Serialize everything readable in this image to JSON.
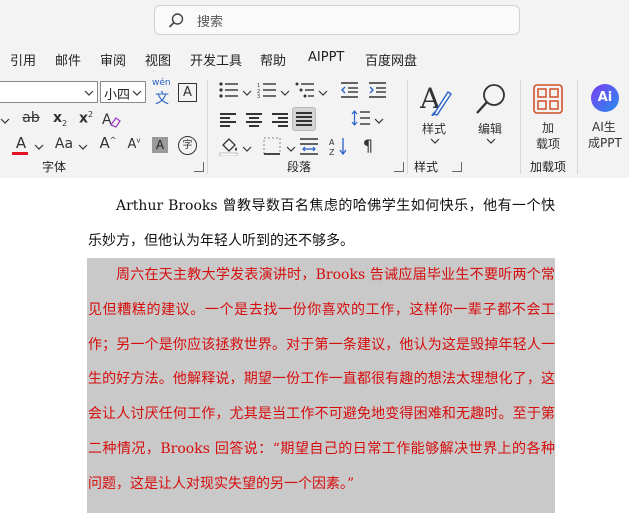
{
  "search": {
    "placeholder": "搜索"
  },
  "menu": [
    "引用",
    "邮件",
    "审阅",
    "视图",
    "开发工具",
    "帮助",
    "AIPPT",
    "百度网盘"
  ],
  "font": {
    "size_value": "小四",
    "phonetic_top": "wén",
    "char_border_glyph": "A"
  },
  "buttons": {
    "style": "样式",
    "edit": "编辑",
    "addin_line1": "加",
    "addin_line2": "载项",
    "ai_line1": "AI生",
    "ai_line2": "成PPT",
    "ai_logo": "Ai"
  },
  "groups": {
    "font": "字体",
    "paragraph": "段落",
    "style": "样式",
    "addins": "加载项"
  },
  "format_glyphs": {
    "strike": "ab",
    "sub": "x",
    "sub_mark": "2",
    "sup": "x",
    "sup_mark": "2",
    "font_color": "A",
    "case": "Aa",
    "grow": "A",
    "shrink": "A",
    "shade": "A",
    "enclose": "字"
  },
  "document": {
    "para1": "Arthur Brooks 曾教导数百名焦虑的哈佛学生如何快乐，他有一个快乐妙方，但他认为年轻人听到的还不够多。",
    "para2": "周六在天主教大学发表演讲时，Brooks 告诫应届毕业生不要听两个常见但糟糕的建议。一个是去找一份你喜欢的工作，这样你一辈子都不会工作；另一个是你应该拯救世界。对于第一条建议，他认为这是毁掉年轻人一生的好方法。他解释说，期望一份工作一直都很有趣的想法太理想化了，这会让人讨厌任何工作，尤其是当工作不可避免地变得困难和无趣时。至于第二种情况，Brooks 回答说：“期望自己的日常工作能够解决世界上的各种问题，这是让人对现实失望的另一个因素。”"
  },
  "colors": {
    "selection": "#c9c9c9",
    "red_text": "#d60d0d",
    "font_color_bar": "#e81123"
  }
}
